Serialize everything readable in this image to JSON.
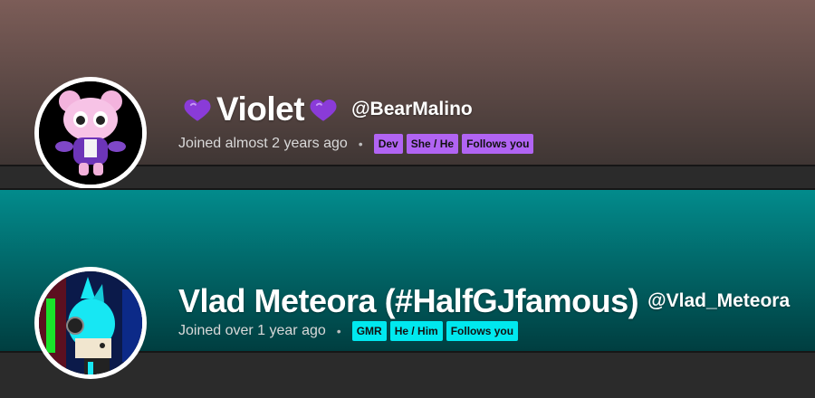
{
  "profiles": [
    {
      "display_name": "Violet",
      "handle": "@BearMalino",
      "joined": "Joined almost 2 years ago",
      "separator": "•",
      "badges": [
        "Dev",
        "She / He",
        "Follows you"
      ],
      "name_icon": "purple-heart-icon",
      "accent": "#b164f3"
    },
    {
      "display_name": "Vlad Meteora (#HalfGJfamous)",
      "handle": "@Vlad_Meteora",
      "joined": "Joined over 1 year ago",
      "separator": "•",
      "badges": [
        "GMR",
        "He / Him",
        "Follows you"
      ],
      "accent": "#00e8ef"
    }
  ]
}
